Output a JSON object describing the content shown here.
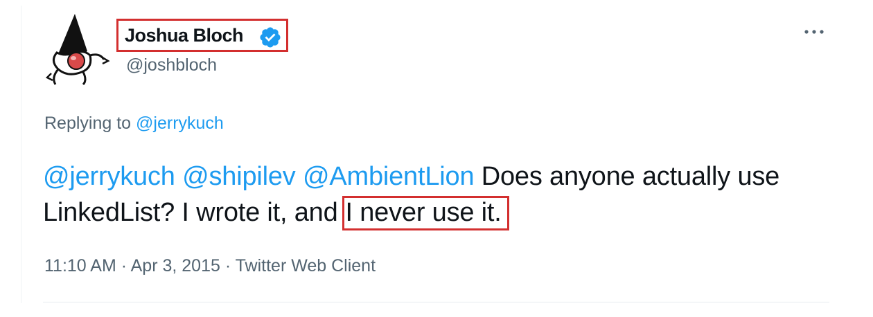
{
  "author": {
    "display_name": "Joshua Bloch",
    "handle": "@joshbloch",
    "verified": true,
    "verified_icon": "verified-badge-icon",
    "avatar_icon": "duke-mascot-avatar"
  },
  "reply": {
    "prefix": "Replying to",
    "to_handle": "@jerrykuch"
  },
  "tweet": {
    "mention_1": "@jerrykuch",
    "mention_2": "@shipilev",
    "mention_3": "@AmbientLion",
    "text_part_1": "Does anyone actually use LinkedList?  I wrote it, and",
    "text_highlight": "I never use it."
  },
  "meta": {
    "time": "11:10 AM",
    "date": "Apr 3, 2015",
    "source": "Twitter Web Client",
    "separator": " · "
  },
  "actions": {
    "more_icon": "more-horizontal-icon"
  },
  "colors": {
    "link": "#1d9bf0",
    "secondary_text": "#536471",
    "highlight_border": "#d32f2f",
    "verified": "#1d9bf0"
  }
}
